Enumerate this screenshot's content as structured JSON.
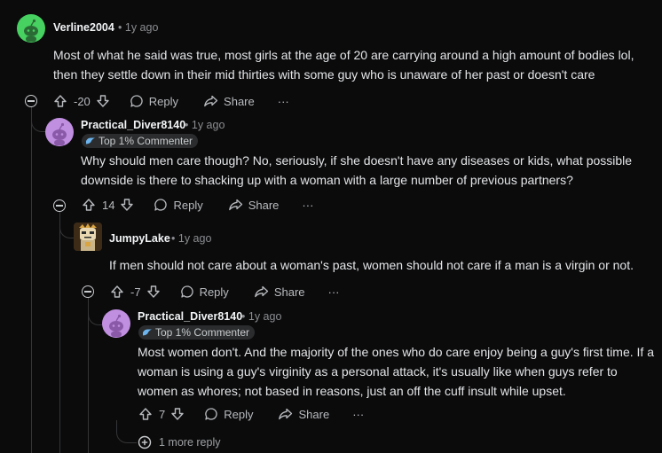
{
  "comments": [
    {
      "username": "Verline2004",
      "time": "1y ago",
      "body": "Most of what he said was true, most girls at the age of 20 are carrying around a high amount of bodies lol, then they settle down in their mid thirties with some guy who is unaware of her past or doesn't care",
      "score": "-20",
      "reply_label": "Reply",
      "share_label": "Share",
      "more_label": "···"
    },
    {
      "username": "Practical_Diver8140",
      "time": "1y ago",
      "badge": "Top 1% Commenter",
      "body": "Why should men care though? No, seriously, if she doesn't have any diseases or kids, what possible downside is there to shacking up with a woman with a large number of previous partners?",
      "score": "14",
      "reply_label": "Reply",
      "share_label": "Share",
      "more_label": "···"
    },
    {
      "username": "JumpyLake",
      "time": "1y ago",
      "body": "If men should not care about a woman's past, women should not care if a man is a virgin or not.",
      "score": "-7",
      "reply_label": "Reply",
      "share_label": "Share",
      "more_label": "···"
    },
    {
      "username": "Practical_Diver8140",
      "time": "1y ago",
      "badge": "Top 1% Commenter",
      "body": "Most women don't. And the majority of the ones who do care enjoy being a guy's first time. If a woman is using a guy's virginity as a personal attack, it's usually like when guys refer to women as whores; not based in reasons, just an off the cuff insult while upset.",
      "score": "7",
      "reply_label": "Reply",
      "share_label": "Share",
      "more_label": "···"
    }
  ],
  "more_replies": "1 more reply",
  "meta_separator": "•",
  "colors": {
    "background": "#0b0b0c",
    "thread_line": "#343536",
    "avatar_green": "#46d160",
    "avatar_purple": "#c18fe0",
    "badge_bg": "#2a2c2e"
  }
}
